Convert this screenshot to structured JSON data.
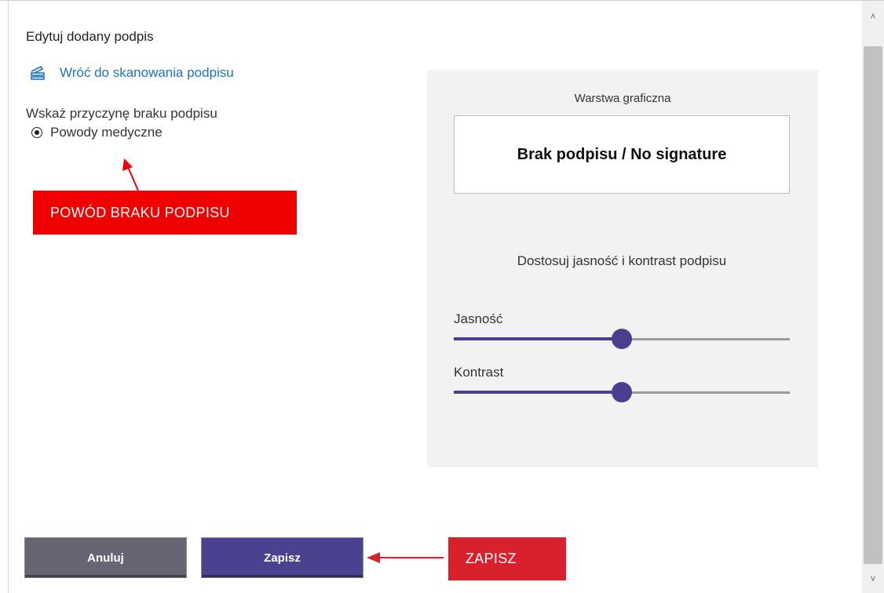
{
  "dialog": {
    "title": "Edytuj dodany podpis",
    "back_link": "Wróć do skanowania podpisu",
    "reason_label": "Wskaż przyczynę braku podpisu",
    "reason_option": "Powody medyczne",
    "reason_selected": true
  },
  "preview": {
    "layer_title": "Warstwa graficzna",
    "signature_text": "Brak podpisu / No signature",
    "adjust_title": "Dostosuj jasność i kontrast podpisu",
    "brightness_label": "Jasność",
    "brightness_level": 0.5,
    "contrast_label": "Kontrast",
    "contrast_level": 0.5
  },
  "buttons": {
    "cancel": "Anuluj",
    "save": "Zapisz"
  },
  "annotations": {
    "reason": "POWÓD BRAKU PODPISU",
    "save": "ZAPISZ"
  },
  "colors": {
    "accent": "#4b428f",
    "link": "#1a73c8",
    "annotation_red": "#f00000"
  },
  "icons": {
    "back": "scanner-icon",
    "scroll_up": "chevron-up-icon",
    "scroll_down": "chevron-down-icon"
  }
}
